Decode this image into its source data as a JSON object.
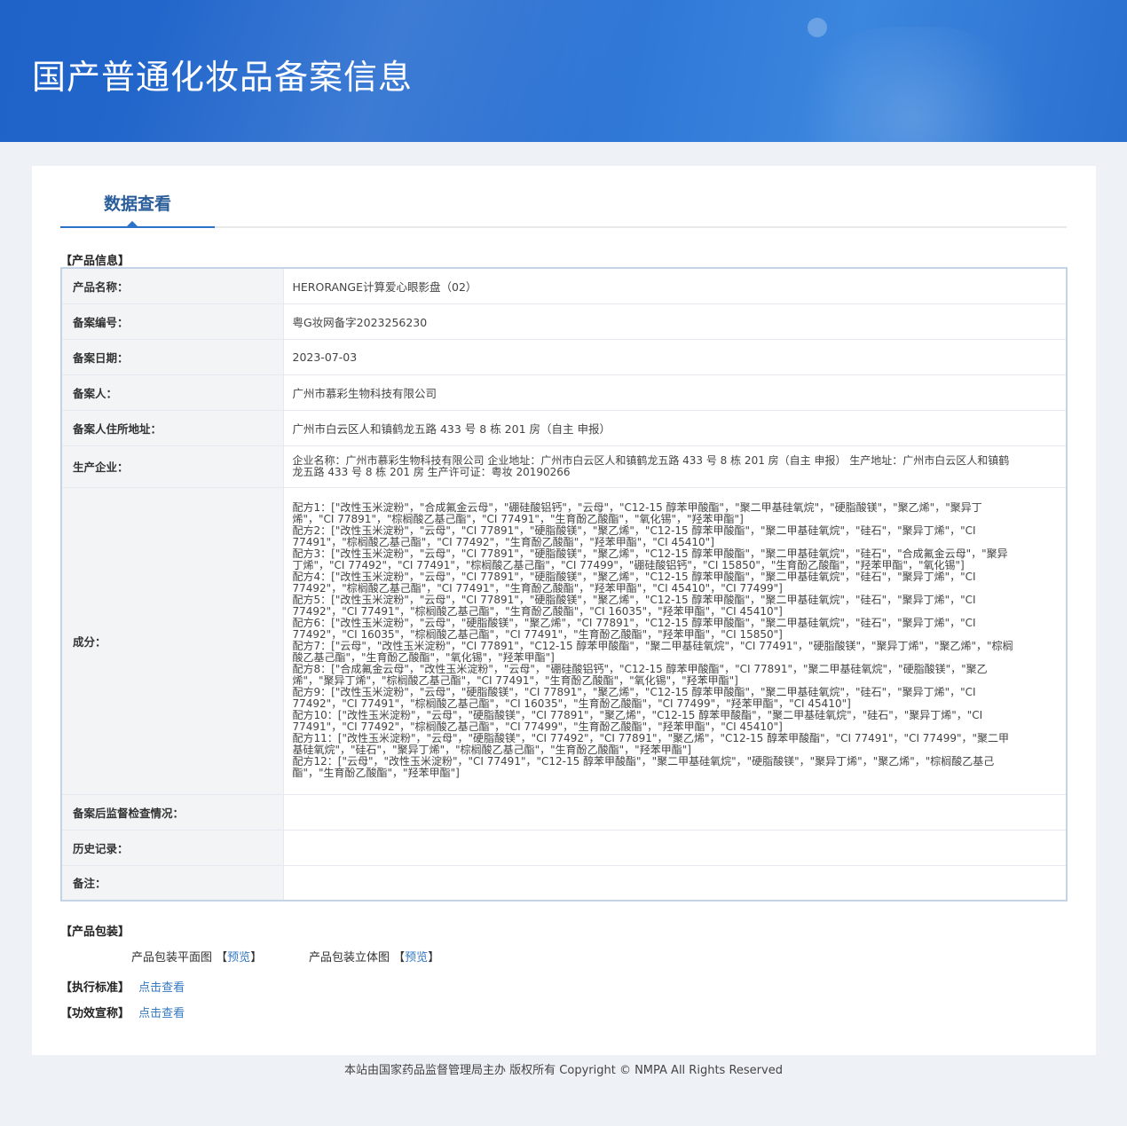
{
  "header": {
    "title": "国产普通化妆品备案信息"
  },
  "tab": {
    "label": "数据查看"
  },
  "sections": {
    "product_info": "【产品信息】",
    "package": "【产品包装】",
    "standard": "【执行标准】",
    "claims": "【功效宣称】"
  },
  "product": {
    "name_label": "产品名称：",
    "name": "HERORANGE计算爱心眼影盘（02）",
    "reg_no_label": "备案编号：",
    "reg_no": "粤G妆网备字2023256230",
    "date_label": "备案日期：",
    "date": "2023-07-03",
    "filer_label": "备案人：",
    "filer": "广州市慕彩生物科技有限公司",
    "address_label": "备案人住所地址：",
    "address": "广州市白云区人和镇鹤龙五路 433 号 8 栋 201 房（自主 申报）",
    "manufacturer_label": "生产企业：",
    "manufacturer": "企业名称：广州市慕彩生物科技有限公司 企业地址：广州市白云区人和镇鹤龙五路 433 号 8 栋 201 房（自主 申报） 生产地址：广州市白云区人和镇鹤龙五路 433 号 8 栋 201 房 生产许可证：粤妆 20190266",
    "ingredients_label": "成分：",
    "ingredients": [
      "配方1：[\"改性玉米淀粉\"，\"合成氟金云母\"，\"硼硅酸铝钙\"，\"云母\"，\"C12-15 醇苯甲酸酯\"，\"聚二甲基硅氧烷\"，\"硬脂酸镁\"，\"聚乙烯\"，\"聚异丁烯\"，\"CI 77891\"，\"棕榈酸乙基己酯\"，\"CI 77491\"，\"生育酚乙酸酯\"，\"氧化锡\"，\"羟苯甲酯\"]",
      "配方2：[\"改性玉米淀粉\"，\"云母\"，\"CI 77891\"，\"硬脂酸镁\"，\"聚乙烯\"，\"C12-15 醇苯甲酸酯\"，\"聚二甲基硅氧烷\"，\"硅石\"，\"聚异丁烯\"，\"CI 77491\"，\"棕榈酸乙基己酯\"，\"CI 77492\"，\"生育酚乙酸酯\"，\"羟苯甲酯\"，\"CI 45410\"]",
      "配方3：[\"改性玉米淀粉\"，\"云母\"，\"CI 77891\"，\"硬脂酸镁\"，\"聚乙烯\"，\"C12-15 醇苯甲酸酯\"，\"聚二甲基硅氧烷\"，\"硅石\"，\"合成氟金云母\"，\"聚异丁烯\"，\"CI 77492\"，\"CI 77491\"，\"棕榈酸乙基己酯\"，\"CI 77499\"，\"硼硅酸铝钙\"，\"CI 15850\"，\"生育酚乙酸酯\"，\"羟苯甲酯\"，\"氧化锡\"]",
      "配方4：[\"改性玉米淀粉\"，\"云母\"，\"CI 77891\"，\"硬脂酸镁\"，\"聚乙烯\"，\"C12-15 醇苯甲酸酯\"，\"聚二甲基硅氧烷\"，\"硅石\"，\"聚异丁烯\"，\"CI 77492\"，\"棕榈酸乙基己酯\"，\"CI 77491\"，\"生育酚乙酸酯\"，\"羟苯甲酯\"，\"CI 45410\"，\"CI 77499\"]",
      "配方5：[\"改性玉米淀粉\"，\"云母\"，\"CI 77891\"，\"硬脂酸镁\"，\"聚乙烯\"，\"C12-15 醇苯甲酸酯\"，\"聚二甲基硅氧烷\"，\"硅石\"，\"聚异丁烯\"，\"CI 77492\"，\"CI 77491\"，\"棕榈酸乙基己酯\"，\"生育酚乙酸酯\"，\"CI 16035\"，\"羟苯甲酯\"，\"CI 45410\"]",
      "配方6：[\"改性玉米淀粉\"，\"云母\"，\"硬脂酸镁\"，\"聚乙烯\"，\"CI 77891\"，\"C12-15 醇苯甲酸酯\"，\"聚二甲基硅氧烷\"，\"硅石\"，\"聚异丁烯\"，\"CI 77492\"，\"CI 16035\"，\"棕榈酸乙基己酯\"，\"CI 77491\"，\"生育酚乙酸酯\"，\"羟苯甲酯\"，\"CI 15850\"]",
      "配方7：[\"云母\"，\"改性玉米淀粉\"，\"CI 77891\"，\"C12-15 醇苯甲酸酯\"，\"聚二甲基硅氧烷\"，\"CI 77491\"，\"硬脂酸镁\"，\"聚异丁烯\"，\"聚乙烯\"，\"棕榈酸乙基己酯\"，\"生育酚乙酸酯\"，\"氧化锡\"，\"羟苯甲酯\"]",
      "配方8：[\"合成氟金云母\"，\"改性玉米淀粉\"，\"云母\"，\"硼硅酸铝钙\"，\"C12-15 醇苯甲酸酯\"，\"CI 77891\"，\"聚二甲基硅氧烷\"，\"硬脂酸镁\"，\"聚乙烯\"，\"聚异丁烯\"，\"棕榈酸乙基己酯\"，\"CI 77491\"，\"生育酚乙酸酯\"，\"氧化锡\"，\"羟苯甲酯\"]",
      "配方9：[\"改性玉米淀粉\"，\"云母\"，\"硬脂酸镁\"，\"CI 77891\"，\"聚乙烯\"，\"C12-15 醇苯甲酸酯\"，\"聚二甲基硅氧烷\"，\"硅石\"，\"聚异丁烯\"，\"CI 77492\"，\"CI 77491\"，\"棕榈酸乙基己酯\"，\"CI 16035\"，\"生育酚乙酸酯\"，\"CI 77499\"，\"羟苯甲酯\"，\"CI 45410\"]",
      "配方10：[\"改性玉米淀粉\"，\"云母\"，\"硬脂酸镁\"，\"CI 77891\"，\"聚乙烯\"，\"C12-15 醇苯甲酸酯\"，\"聚二甲基硅氧烷\"，\"硅石\"，\"聚异丁烯\"，\"CI 77491\"，\"CI 77492\"，\"棕榈酸乙基己酯\"，\"CI 77499\"，\"生育酚乙酸酯\"，\"羟苯甲酯\"，\"CI 45410\"]",
      "配方11：[\"改性玉米淀粉\"，\"云母\"，\"硬脂酸镁\"，\"CI 77492\"，\"CI 77891\"，\"聚乙烯\"，\"C12-15 醇苯甲酸酯\"，\"CI 77491\"，\"CI 77499\"，\"聚二甲基硅氧烷\"，\"硅石\"，\"聚异丁烯\"，\"棕榈酸乙基己酯\"，\"生育酚乙酸酯\"，\"羟苯甲酯\"]",
      "配方12：[\"云母\"，\"改性玉米淀粉\"，\"CI 77491\"，\"C12-15 醇苯甲酸酯\"，\"聚二甲基硅氧烷\"，\"硬脂酸镁\"，\"聚异丁烯\"，\"聚乙烯\"，\"棕榈酸乙基己酯\"，\"生育酚乙酸酯\"，\"羟苯甲酯\"]"
    ],
    "inspection_label": "备案后监督检查情况：",
    "inspection": "",
    "history_label": "历史记录：",
    "history": "",
    "remark_label": "备注：",
    "remark": ""
  },
  "package": {
    "flat_label": "产品包装平面图",
    "flat_link": "预览",
    "solid_label": "产品包装立体图",
    "solid_link": "预览"
  },
  "links": {
    "standard_link": "点击查看",
    "claims_link": "点击查看"
  },
  "footer": {
    "text": "本站由国家药品监督管理局主办 版权所有 Copyright © NMPA All Rights Reserved"
  }
}
